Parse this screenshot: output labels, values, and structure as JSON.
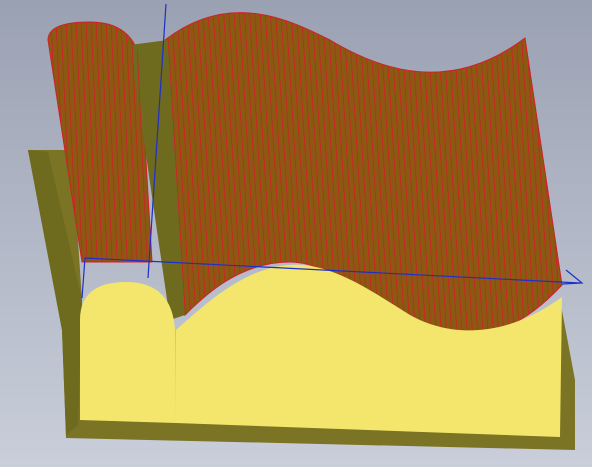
{
  "viewport": {
    "background_top": "#9aa1b2",
    "background_bottom": "#c9ceda"
  },
  "model": {
    "base_color": "#7a7424",
    "wall_color": "#6e6a1e",
    "top_surface_color": "#8a5a12",
    "front_face_color": "#f4e66c",
    "toolpath_color": "#d0202a"
  },
  "axes": {
    "x_axis_color": "#1e2fc8",
    "y_axis_color": "#1e2fc8"
  }
}
